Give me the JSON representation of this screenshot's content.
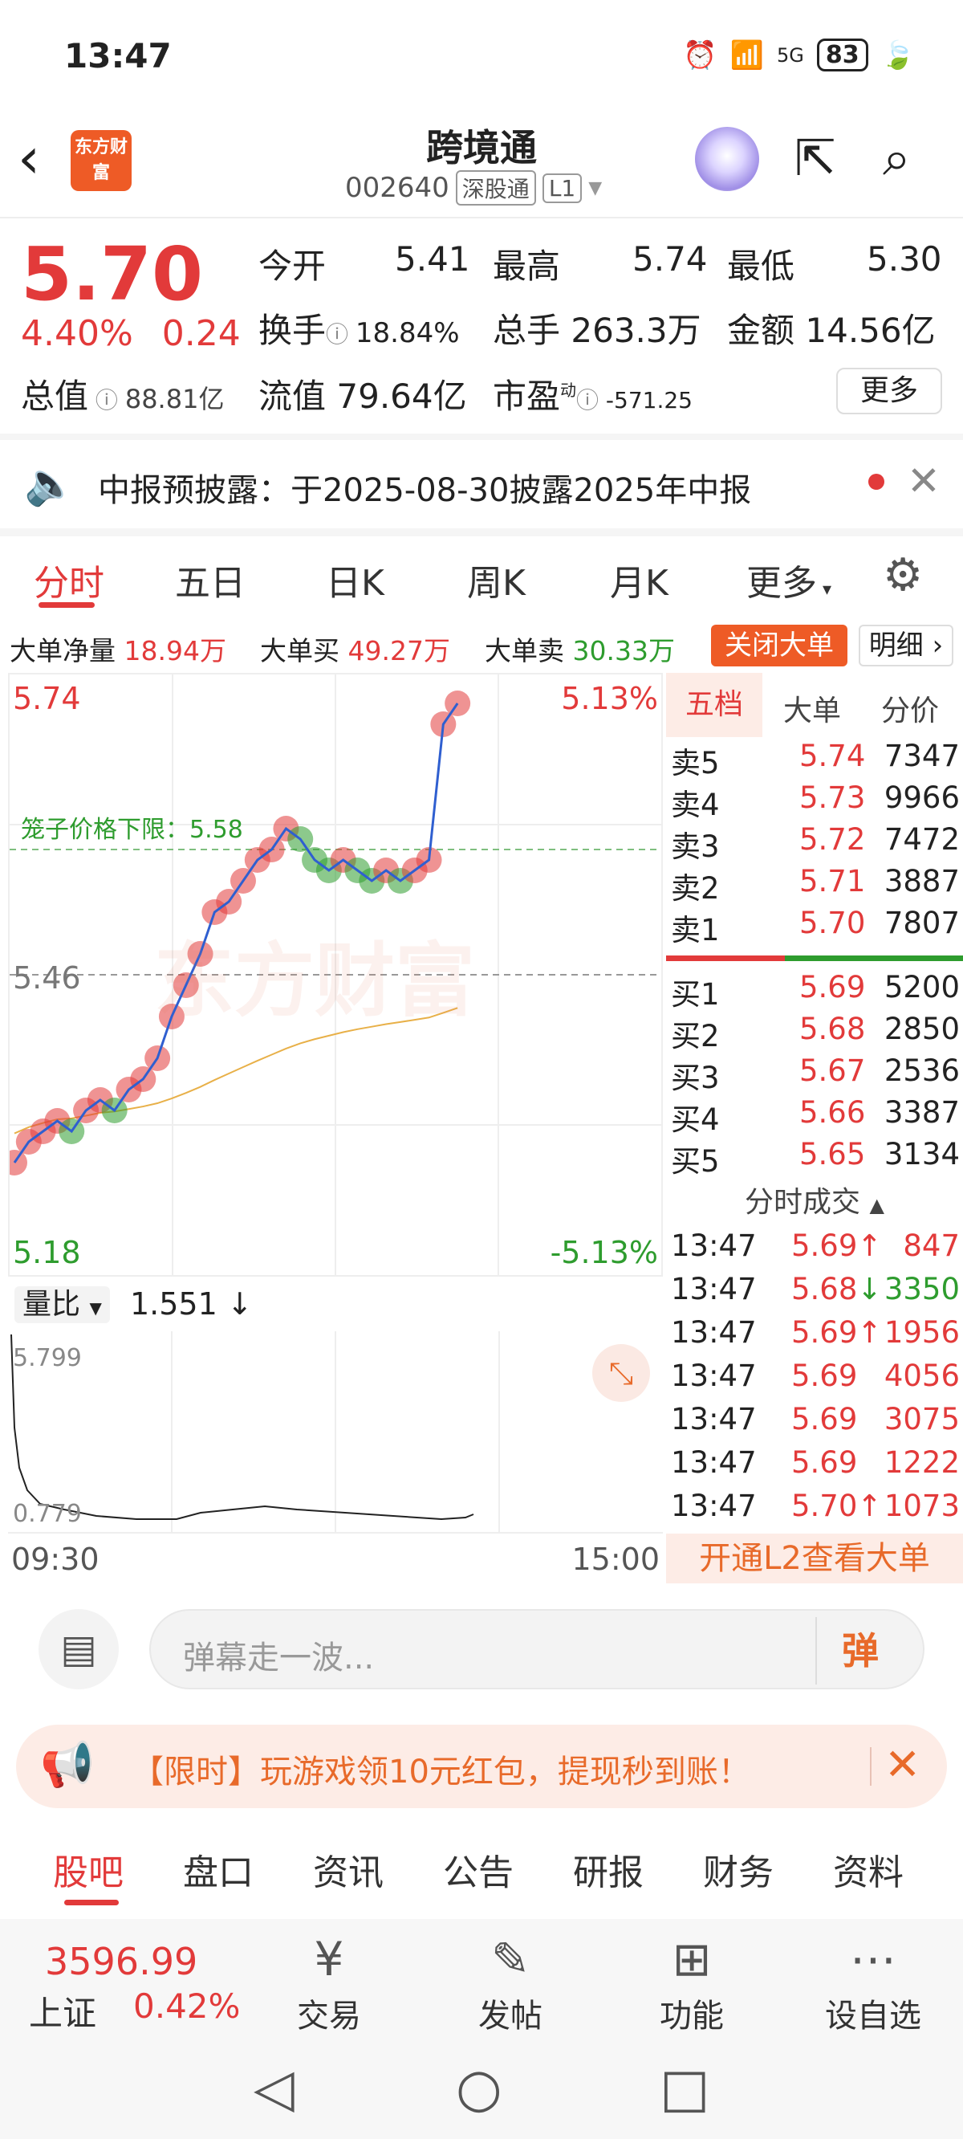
{
  "status": {
    "time": "13:47",
    "signal": "5G",
    "battery": "83"
  },
  "header": {
    "logo": "东方财富",
    "title": "跨境通",
    "code": "002640",
    "market": "深股通",
    "level": "L1"
  },
  "quote": {
    "price": "5.70",
    "pct": "4.40%",
    "chg": "0.24",
    "total_cap_label": "总值",
    "total_cap": "88.81亿",
    "open_label": "今开",
    "open": "5.41",
    "high_label": "最高",
    "high": "5.74",
    "low_label": "最低",
    "low": "5.30",
    "turnover_label": "换手",
    "turnover": "18.84%",
    "vol_label": "总手",
    "vol": "263.3万",
    "amount_label": "金额",
    "amount": "14.56亿",
    "float_label": "流值",
    "float_cap": "79.64亿",
    "pe_label": "市盈",
    "pe_sup": "动",
    "pe": "-571.25",
    "more": "更多"
  },
  "notice": {
    "text": "中报预披露：于2025-08-30披露2025年中报"
  },
  "tabs": [
    "分时",
    "五日",
    "日K",
    "周K",
    "月K",
    "更多"
  ],
  "flow": {
    "net_label": "大单净量",
    "net": "18.94万",
    "buy_label": "大单买",
    "buy": "49.27万",
    "sell_label": "大单卖",
    "sell": "30.33万",
    "close_btn": "关闭大单",
    "detail_btn": "明细"
  },
  "chart": {
    "top_price": "5.74",
    "top_pct": "5.13%",
    "mid_price": "5.46",
    "bottom_price": "5.18",
    "bottom_pct": "-5.13%",
    "cage": "笼子价格下限：5.58",
    "watermark": "东方财富",
    "ratio_label": "量比",
    "ratio": "1.551",
    "ratio_top": "5.799",
    "ratio_bottom": "0.779",
    "start": "09:30",
    "end": "15:00"
  },
  "chart_data": {
    "type": "line",
    "xlabel": "",
    "ylabel": "",
    "ylim": [
      5.18,
      5.74
    ],
    "series": [
      {
        "name": "",
        "values": [
          5.28,
          5.3,
          5.31,
          5.32,
          5.31,
          5.33,
          5.34,
          5.33,
          5.35,
          5.36,
          5.38,
          5.42,
          5.45,
          5.48,
          5.52,
          5.53,
          5.55,
          5.57,
          5.58,
          5.6,
          5.59,
          5.57,
          5.56,
          5.57,
          5.56,
          5.55,
          5.56,
          5.55,
          5.56,
          5.57,
          5.7,
          5.72
        ]
      }
    ]
  },
  "orderbook": {
    "tabs": [
      "五档",
      "大单",
      "分价"
    ],
    "asks": [
      {
        "label": "卖5",
        "price": "5.74",
        "vol": "7347"
      },
      {
        "label": "卖4",
        "price": "5.73",
        "vol": "9966"
      },
      {
        "label": "卖3",
        "price": "5.72",
        "vol": "7472"
      },
      {
        "label": "卖2",
        "price": "5.71",
        "vol": "3887"
      },
      {
        "label": "卖1",
        "price": "5.70",
        "vol": "7807"
      }
    ],
    "bids": [
      {
        "label": "买1",
        "price": "5.69",
        "vol": "5200"
      },
      {
        "label": "买2",
        "price": "5.68",
        "vol": "2850"
      },
      {
        "label": "买3",
        "price": "5.67",
        "vol": "2536"
      },
      {
        "label": "买4",
        "price": "5.66",
        "vol": "3387"
      },
      {
        "label": "买5",
        "price": "5.65",
        "vol": "3134"
      }
    ],
    "trades_title": "分时成交",
    "trades": [
      {
        "t": "13:47",
        "p": "5.69",
        "d": "↑",
        "v": "847"
      },
      {
        "t": "13:47",
        "p": "5.68",
        "d": "↓",
        "v": "3350"
      },
      {
        "t": "13:47",
        "p": "5.69",
        "d": "↑",
        "v": "1956"
      },
      {
        "t": "13:47",
        "p": "5.69",
        "d": "",
        "v": "4056"
      },
      {
        "t": "13:47",
        "p": "5.69",
        "d": "",
        "v": "3075"
      },
      {
        "t": "13:47",
        "p": "5.69",
        "d": "",
        "v": "1222"
      },
      {
        "t": "13:47",
        "p": "5.70",
        "d": "↑",
        "v": "1073"
      }
    ],
    "l2": "开通L2查看大单"
  },
  "comment": {
    "placeholder": "弹幕走一波...",
    "btn": "弹"
  },
  "promo": {
    "text": "【限时】玩游戏领10元红包，提现秒到账！"
  },
  "bottom_tabs": [
    "股吧",
    "盘口",
    "资讯",
    "公告",
    "研报",
    "财务",
    "资料"
  ],
  "dock": {
    "index_value": "3596.99",
    "index_name": "上证",
    "index_pct": "0.42%",
    "actions": [
      "交易",
      "发帖",
      "功能",
      "设自选"
    ]
  }
}
